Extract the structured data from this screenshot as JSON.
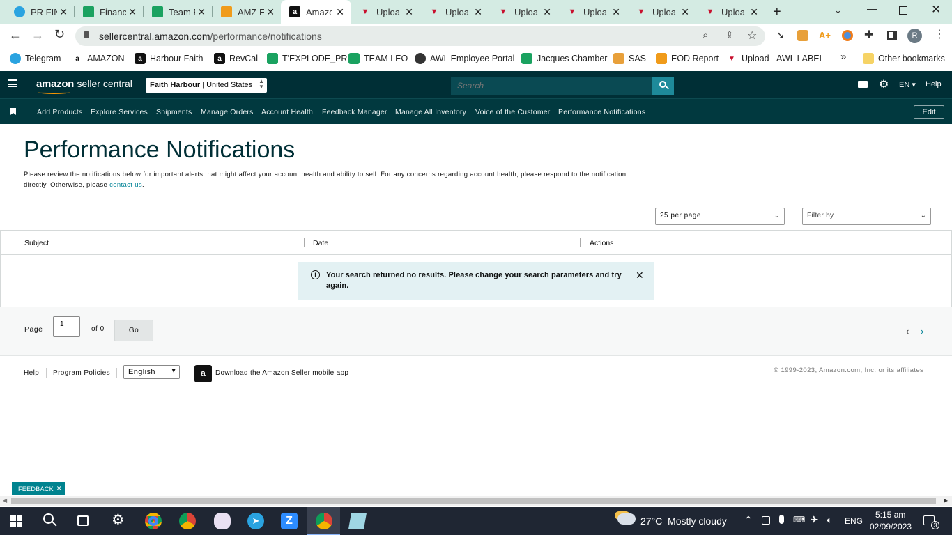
{
  "browser": {
    "tabs": [
      {
        "title": "PR FIN",
        "fav": "telegram-icon",
        "color": "#2aa3e0"
      },
      {
        "title": "Financ",
        "fav": "sheets-icon",
        "color": "#1aa260"
      },
      {
        "title": "Team E",
        "fav": "sheets-icon",
        "color": "#1aa260"
      },
      {
        "title": "AMZ E",
        "fav": "edit-icon",
        "color": "#f09b1a"
      },
      {
        "title": "Amazo",
        "fav": "amazon-icon",
        "color": "#111111"
      },
      {
        "title": "Uploa",
        "fav": "upload-icon",
        "color": "#c8102e"
      },
      {
        "title": "Uploa",
        "fav": "upload-icon",
        "color": "#c8102e"
      },
      {
        "title": "Uploa",
        "fav": "upload-icon",
        "color": "#c8102e"
      },
      {
        "title": "Uploa",
        "fav": "upload-icon",
        "color": "#c8102e"
      },
      {
        "title": "Uploa",
        "fav": "upload-icon",
        "color": "#c8102e"
      },
      {
        "title": "Uploa",
        "fav": "upload-icon",
        "color": "#c8102e"
      }
    ],
    "url_domain": "sellercentral.amazon.com",
    "url_path": "/performance/notifications",
    "profile_initial": "R",
    "bookmarks": [
      {
        "label": "Telegram",
        "color": "#2aa3e0"
      },
      {
        "label": "AMAZON",
        "color": "#ffffff"
      },
      {
        "label": "Harbour Faith",
        "color": "#111111"
      },
      {
        "label": "RevCal",
        "color": "#111111"
      },
      {
        "label": "T'EXPLODE_PR",
        "color": "#1aa260"
      },
      {
        "label": "TEAM LEO",
        "color": "#1aa260"
      },
      {
        "label": "AWL Employee Portal",
        "color": "#333333"
      },
      {
        "label": "Jacques Chamber",
        "color": "#1aa260"
      },
      {
        "label": "SAS",
        "color": "#e8a03a"
      },
      {
        "label": "EOD Report",
        "color": "#f09b1a"
      },
      {
        "label": "Upload - AWL LABEL",
        "color": "#c8102e"
      }
    ],
    "other_bookmarks": "Other bookmarks",
    "more": "»"
  },
  "header": {
    "logo_main": "amazon",
    "logo_sub": "seller central",
    "account_name": "Faith Harbour",
    "account_region": "| United States",
    "search_placeholder": "Search",
    "language": "EN",
    "help": "Help"
  },
  "nav": {
    "items": [
      "Add Products",
      "Explore Services",
      "Shipments",
      "Manage Orders",
      "Account Health",
      "Feedback Manager",
      "Manage All Inventory",
      "Voice of the Customer",
      "Performance Notifications"
    ],
    "edit": "Edit"
  },
  "main": {
    "title": "Performance Notifications",
    "desc_1": "Please review the notifications below for important alerts that might affect your account health and ability to sell. For any concerns regarding account health, please respond to the notification directly. Otherwise, please ",
    "desc_link": "contact us",
    "desc_2": ".",
    "per_page": "25 per page",
    "filter": "Filter by",
    "columns": [
      "Subject",
      "Date",
      "Actions"
    ],
    "alert": "Your search returned no results. Please change your search parameters and try again."
  },
  "pager": {
    "page_label": "Page",
    "page_value": "1",
    "of_label": "of 0",
    "go": "Go"
  },
  "footer": {
    "help": "Help",
    "policies": "Program Policies",
    "language": "English",
    "app": "Download the Amazon Seller mobile app",
    "copyright": "© 1999-2023, Amazon.com, Inc. or its affiliates"
  },
  "feedback": "FEEDBACK",
  "taskbar": {
    "weather": "27°C  Mostly cloudy",
    "lang": "ENG",
    "time": "5:15 am",
    "date": "02/09/2023",
    "notif_count": "3"
  }
}
